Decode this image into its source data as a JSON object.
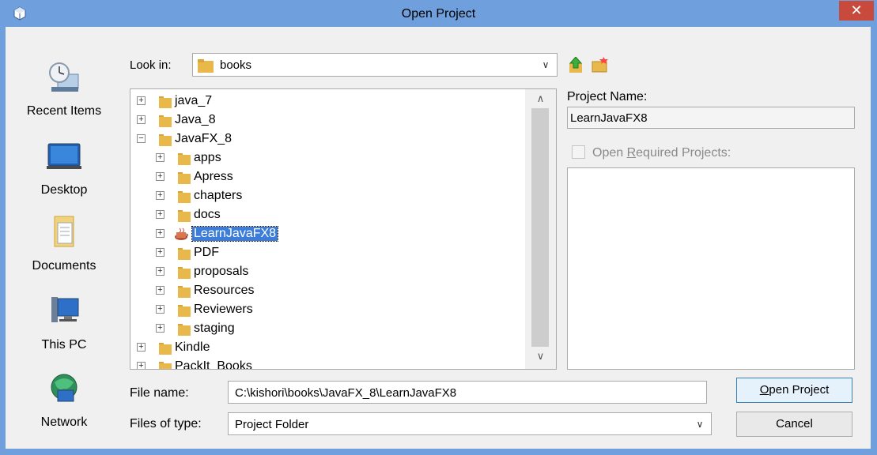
{
  "window": {
    "title": "Open Project",
    "close_glyph": "✕"
  },
  "places": [
    {
      "label": "Recent Items",
      "icon": "recent-items-icon"
    },
    {
      "label": "Desktop",
      "icon": "desktop-icon"
    },
    {
      "label": "Documents",
      "icon": "documents-icon"
    },
    {
      "label": "This PC",
      "icon": "this-pc-icon"
    },
    {
      "label": "Network",
      "icon": "network-icon"
    }
  ],
  "look_in": {
    "label": "Look in:",
    "value": "books"
  },
  "tree": [
    {
      "name": "java_7",
      "depth": 0
    },
    {
      "name": "Java_8",
      "depth": 0
    },
    {
      "name": "JavaFX_8",
      "depth": 0,
      "expanded": true
    },
    {
      "name": "apps",
      "depth": 1
    },
    {
      "name": "Apress",
      "depth": 1
    },
    {
      "name": "chapters",
      "depth": 1
    },
    {
      "name": "docs",
      "depth": 1
    },
    {
      "name": "LearnJavaFX8",
      "depth": 1,
      "selected": true,
      "project": true
    },
    {
      "name": "PDF",
      "depth": 1
    },
    {
      "name": "proposals",
      "depth": 1
    },
    {
      "name": "Resources",
      "depth": 1
    },
    {
      "name": "Reviewers",
      "depth": 1
    },
    {
      "name": "staging",
      "depth": 1
    },
    {
      "name": "Kindle",
      "depth": 0
    },
    {
      "name": "PackIt_Books",
      "depth": 0
    }
  ],
  "project_name": {
    "label": "Project Name:",
    "value": "LearnJavaFX8"
  },
  "open_required": {
    "label_pre": "Open ",
    "label_mnemonic": "R",
    "label_post": "equired Projects:"
  },
  "file_name": {
    "label": "File name:",
    "value": "C:\\kishori\\books\\JavaFX_8\\LearnJavaFX8"
  },
  "files_of_type": {
    "label": "Files of type:",
    "value": "Project Folder"
  },
  "buttons": {
    "open_pre": "",
    "open_mnemonic": "O",
    "open_post": "pen Project",
    "cancel": "Cancel"
  },
  "colors": {
    "title_bar": "#6f9fdc",
    "close": "#c74a3c",
    "selection": "#3b7dd8",
    "folder": "#e8b84a"
  }
}
